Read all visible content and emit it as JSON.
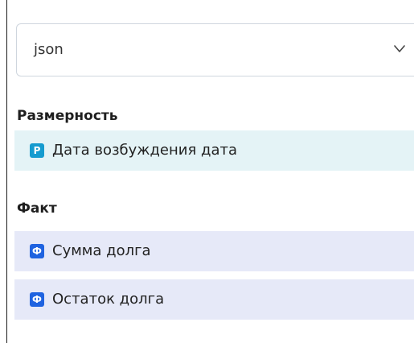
{
  "format_select": {
    "value": "json",
    "chevron_icon": "chevron-down-icon"
  },
  "dimensions": {
    "title": "Размерность",
    "items": [
      {
        "badge": "P",
        "label": "Дата возбуждения дата",
        "icon": "dimension-badge-icon"
      }
    ]
  },
  "facts": {
    "title": "Факт",
    "items": [
      {
        "badge": "Ф",
        "label": "Сумма долга",
        "icon": "fact-badge-icon"
      },
      {
        "badge": "Ф",
        "label": "Остаток долга",
        "icon": "fact-badge-icon"
      }
    ]
  },
  "colors": {
    "dimension_row_bg": "#e4f3f6",
    "dimension_badge": "#159bcf",
    "fact_row_bg": "#e6e9f8",
    "fact_badge": "#1f63e0"
  }
}
